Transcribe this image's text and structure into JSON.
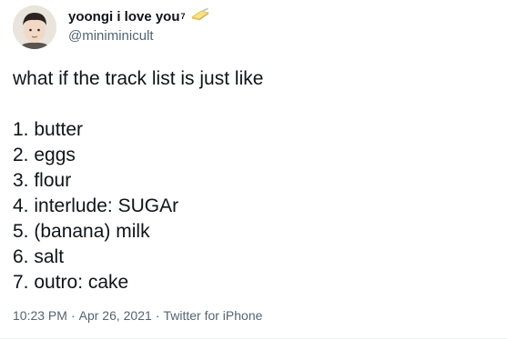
{
  "tweet": {
    "display_name": "yoongi i love you",
    "display_name_superscript": "7",
    "display_name_emoji": "butter-emoji",
    "handle": "@miniminicult",
    "intro": "what if the track list is just like",
    "tracks": [
      "1. butter",
      "2. eggs",
      "3. flour",
      "4. interlude: SUGAr",
      "5. (banana) milk",
      "6. salt",
      "7. outro: cake"
    ],
    "time": "10:23 PM",
    "date": "Apr 26, 2021",
    "separator": "·",
    "source": "Twitter for iPhone"
  },
  "colors": {
    "text": "#0f1419",
    "secondary": "#536471",
    "divider": "#eff3f4",
    "butter": "#f6e08a"
  }
}
